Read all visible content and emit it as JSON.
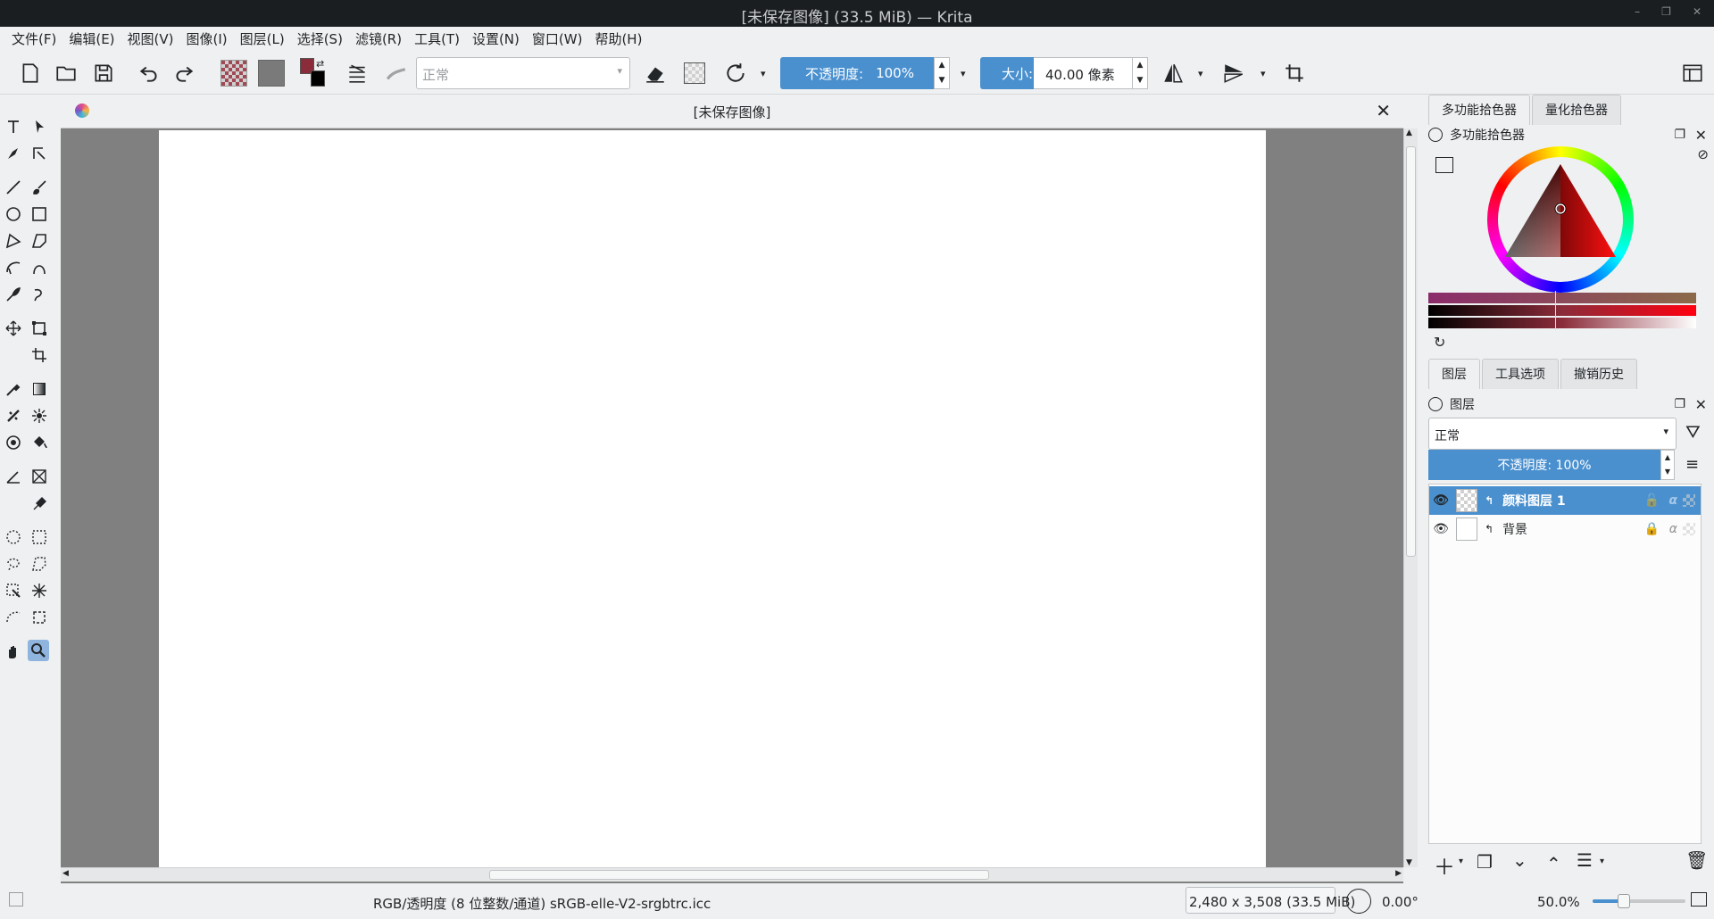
{
  "window": {
    "title": "[未保存图像] (33.5 MiB) — Krita",
    "minimize": "–",
    "restore": "❐",
    "close": "✕"
  },
  "menu": [
    "文件(F)",
    "编辑(E)",
    "视图(V)",
    "图像(I)",
    "图层(L)",
    "选择(S)",
    "滤镜(R)",
    "工具(T)",
    "设置(N)",
    "窗口(W)",
    "帮助(H)"
  ],
  "toolbar": {
    "blend_mode": "正常",
    "opacity_label": "不透明度:",
    "opacity_value": "100%",
    "size_label": "大小:",
    "size_value": "40.00 像素",
    "fg_color": "#8b2c3a",
    "bg_color": "#000000"
  },
  "document": {
    "tab_title": "[未保存图像]"
  },
  "docker": {
    "color_tabs": [
      "多功能拾色器",
      "量化拾色器"
    ],
    "color_panel_title": "多功能拾色器",
    "layer_tabs": [
      "图层",
      "工具选项",
      "撤销历史"
    ],
    "layers_panel_title": "图层",
    "layer_blend_mode": "正常",
    "layer_opacity": "不透明度: 100%",
    "layers": [
      {
        "name": "颜料图层 1",
        "selected": true,
        "locked": false
      },
      {
        "name": "背景",
        "selected": false,
        "locked": true
      }
    ]
  },
  "status": {
    "color_profile": "RGB/透明度 (8 位整数/通道)  sRGB-elle-V2-srgbtrc.icc",
    "dimensions": "2,480 x 3,508 (33.5 MiB)",
    "rotation": "0.00°",
    "zoom": "50.0%"
  },
  "colors": {
    "accent": "#4a90cf",
    "canvas_bg": "#808080",
    "titlebar": "#1b1e20"
  }
}
